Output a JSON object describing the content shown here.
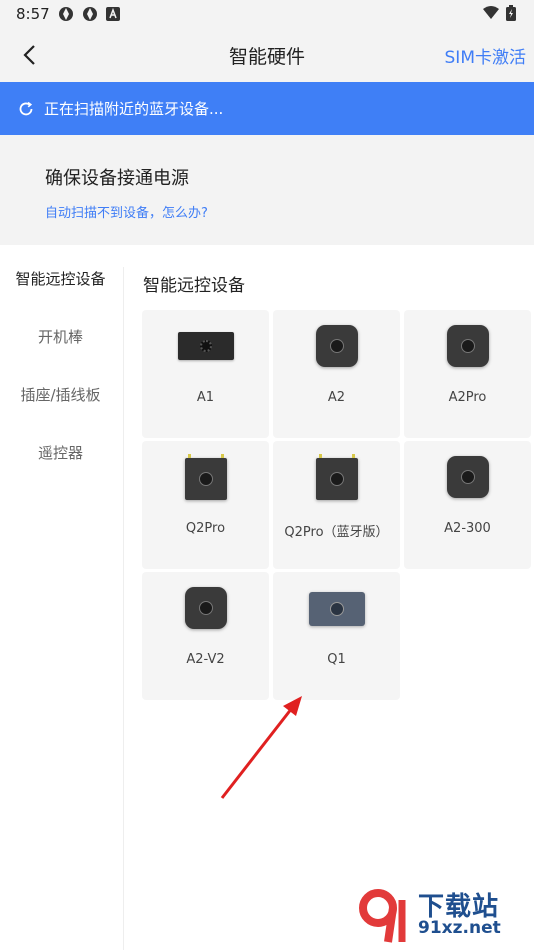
{
  "status_bar": {
    "time": "8:57",
    "left_icons": [
      "app-icon",
      "app-icon",
      "a-icon"
    ],
    "right_icons": [
      "wifi-icon",
      "battery-icon"
    ]
  },
  "nav": {
    "title": "智能硬件",
    "action": "SIM卡激活",
    "back_icon": "chevron-left-icon"
  },
  "scan_banner": {
    "text": "正在扫描附近的蓝牙设备...",
    "icon": "refresh-icon",
    "color": "#3f7ff6"
  },
  "info": {
    "title": "确保设备接通电源",
    "link": "自动扫描不到设备，怎么办?"
  },
  "sidebar": {
    "items": [
      {
        "label": "智能远控设备",
        "active": true
      },
      {
        "label": "开机棒",
        "active": false
      },
      {
        "label": "插座/插线板",
        "active": false
      },
      {
        "label": "遥控器",
        "active": false
      }
    ]
  },
  "section": {
    "title": "智能远控设备"
  },
  "devices": [
    {
      "label": "A1"
    },
    {
      "label": "A2"
    },
    {
      "label": "A2Pro"
    },
    {
      "label": "Q2Pro"
    },
    {
      "label": "Q2Pro（蓝牙版）"
    },
    {
      "label": "A2-300"
    },
    {
      "label": "A2-V2"
    },
    {
      "label": "Q1"
    }
  ],
  "watermark": {
    "cn": "下载站",
    "en": "91xz.net"
  },
  "colors": {
    "accent": "#3f7df6",
    "arrow": "#e02020"
  }
}
